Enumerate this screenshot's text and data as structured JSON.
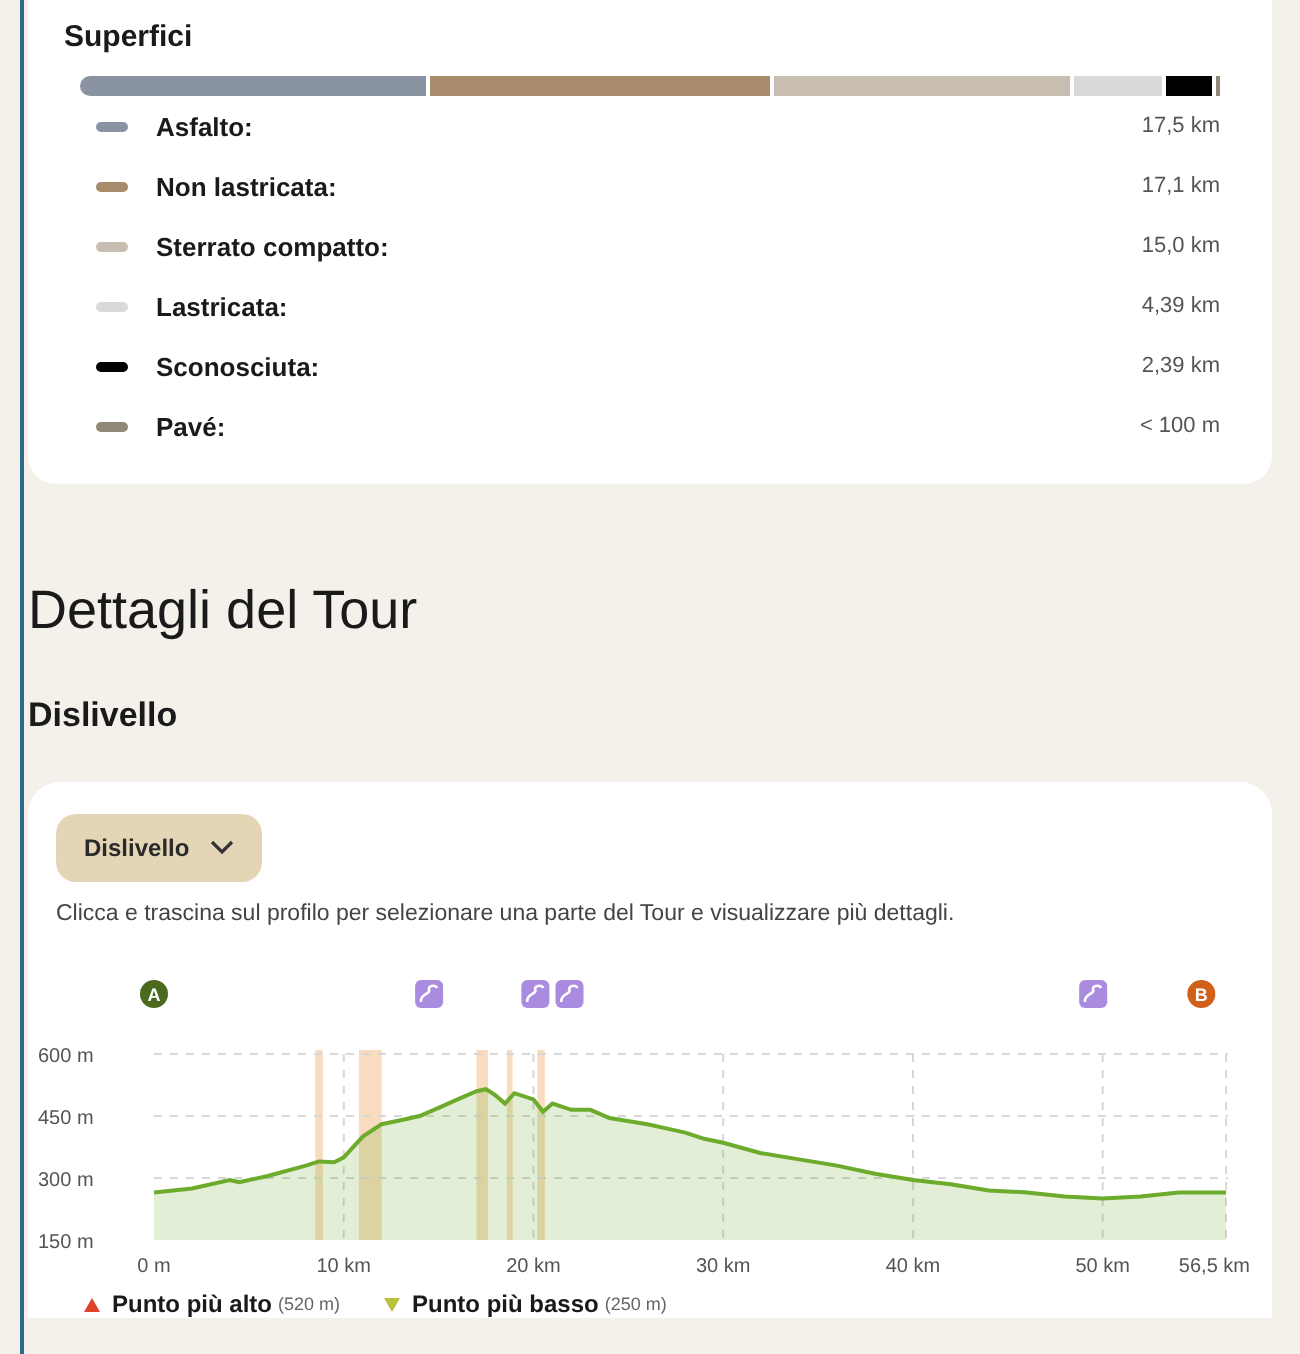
{
  "surfaces": {
    "title": "Superfici",
    "items": [
      {
        "label": "Asfalto:",
        "value": "17,5 km",
        "color": "#8a93a2"
      },
      {
        "label": "Non lastricata:",
        "value": "17,1 km",
        "color": "#a78b6b"
      },
      {
        "label": "Sterrato compatto:",
        "value": "15,0 km",
        "color": "#c7bdb1"
      },
      {
        "label": "Lastricata:",
        "value": "4,39 km",
        "color": "#d9d9d9"
      },
      {
        "label": "Sconosciuta:",
        "value": "2,39 km",
        "color": "#000000"
      },
      {
        "label": "Pavé:",
        "value": "< 100 m",
        "color": "#8f8878"
      }
    ]
  },
  "details": {
    "title": "Dettagli del Tour",
    "subtitle": "Dislivello",
    "elevation": {
      "dropdown": "Dislivello",
      "caption": "Clicca e trascina sul profilo per selezionare una parte del Tour e visualizzare più dettagli.",
      "chart_data": {
        "type": "area",
        "x": [
          0,
          2,
          4,
          4.5,
          6,
          8,
          8.7,
          9.5,
          10,
          11,
          12,
          13,
          14,
          15,
          16,
          17,
          17.5,
          18,
          18.5,
          19,
          20,
          20.5,
          21,
          22,
          23,
          24,
          26,
          27,
          28,
          29,
          30,
          32,
          34,
          36,
          38,
          40,
          42,
          44,
          46,
          48,
          50,
          52,
          54,
          56.5
        ],
        "grid": true,
        "series": [
          {
            "color": "#6cab2c",
            "values": [
              265,
              275,
              295,
              290,
              305,
              330,
              340,
              338,
              350,
              400,
              430,
              440,
              450,
              470,
              490,
              510,
              515,
              500,
              480,
              505,
              490,
              460,
              480,
              465,
              465,
              445,
              430,
              420,
              410,
              395,
              385,
              360,
              345,
              330,
              310,
              295,
              285,
              270,
              265,
              255,
              250,
              255,
              265,
              265
            ]
          }
        ],
        "xlim": [
          0,
          56.5
        ],
        "ylim": [
          150,
          600
        ],
        "xticks": [
          {
            "value": 0,
            "label": "0 m"
          },
          {
            "value": 10,
            "label": "10 km"
          },
          {
            "value": 20,
            "label": "20 km"
          },
          {
            "value": 30,
            "label": "30 km"
          },
          {
            "value": 40,
            "label": "40 km"
          },
          {
            "value": 50,
            "label": "50 km"
          },
          {
            "value": 56.5,
            "label": "56,5 km"
          }
        ],
        "yticks": [
          {
            "value": 150,
            "label": "150 m"
          },
          {
            "value": 300,
            "label": "300 m"
          },
          {
            "value": 450,
            "label": "450 m"
          },
          {
            "value": 600,
            "label": "600 m"
          }
        ]
      },
      "waypoints": [
        {
          "kind": "point",
          "label": "A",
          "color": "#4b6a1e"
        },
        {
          "kind": "road"
        },
        {
          "kind": "road"
        },
        {
          "kind": "road"
        },
        {
          "kind": "road"
        },
        {
          "kind": "point",
          "label": "B",
          "color": "#d1601a"
        }
      ],
      "legend": [
        {
          "kind": "high",
          "label": "Punto più alto",
          "value": "(520 m)"
        },
        {
          "kind": "low",
          "label": "Punto più basso",
          "value": "(250 m)"
        }
      ]
    }
  }
}
